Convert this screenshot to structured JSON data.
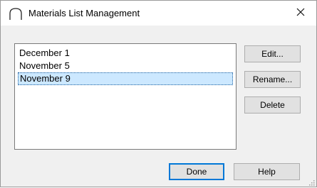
{
  "window": {
    "title": "Materials List Management",
    "close_glyph": "✕"
  },
  "list": {
    "items": [
      {
        "label": "December 1"
      },
      {
        "label": "November 5"
      },
      {
        "label": "November 9",
        "selected": true
      }
    ]
  },
  "buttons": {
    "edit": "Edit...",
    "rename": "Rename...",
    "delete": "Delete",
    "done": "Done",
    "help": "Help"
  },
  "icons": {
    "title": "arch-door-icon",
    "close": "close-icon",
    "grip": "resize-grip-icon"
  },
  "colors": {
    "selection": "#cce8ff",
    "default_button_border": "#0078d7",
    "dialog_background": "#f0f0f0"
  }
}
